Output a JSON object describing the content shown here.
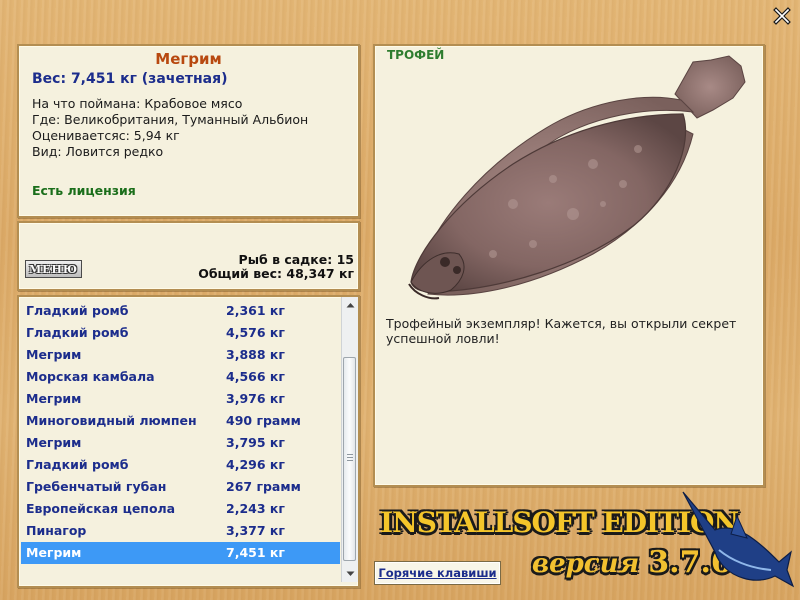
{
  "close": {
    "icon": "close-icon"
  },
  "catch_info": {
    "fish_name": "Мегрим",
    "weight": "Вес: 7,451 кг (зачетная)",
    "bait": "На что поймана: Крабовое мясо",
    "where": "Где: Великобритания, Туманный Альбион",
    "rated_from": "Оцениваетсяс: 5,94 кг",
    "kind": "Вид: Ловится редко",
    "license": "Есть лицензия"
  },
  "keepnet": {
    "menu_label": "МЕНЮ",
    "fish_count": "Рыб в садке: 15",
    "total_weight": "Общий вес: 48,347 кг"
  },
  "catch_list": {
    "rows": [
      {
        "name": "Гладкий ромб",
        "weight": "2,361 кг"
      },
      {
        "name": "Гладкий ромб",
        "weight": "4,576 кг"
      },
      {
        "name": "Мегрим",
        "weight": "3,888 кг"
      },
      {
        "name": "Морская камбала",
        "weight": "4,566 кг"
      },
      {
        "name": "Мегрим",
        "weight": "3,976 кг"
      },
      {
        "name": "Миноговидный люмпен",
        "weight": "490 грамм"
      },
      {
        "name": "Мегрим",
        "weight": "3,795 кг"
      },
      {
        "name": "Гладкий ромб",
        "weight": "4,296 кг"
      },
      {
        "name": "Гребенчатый губан",
        "weight": "267 грамм"
      },
      {
        "name": "Европейская цепола",
        "weight": "2,243 кг"
      },
      {
        "name": "Пинагор",
        "weight": "3,377 кг"
      },
      {
        "name": "Мегрим",
        "weight": "7,451 кг"
      }
    ],
    "selected_index": 11
  },
  "trophy": {
    "label": "ТРОФЕЙ",
    "message": "Трофейный экземпляр! Кажется, вы открыли секрет успешной ловли!"
  },
  "footer": {
    "hotkeys_label": "Горячие клавиши",
    "logo_text": "INSTALLSOFT EDITION",
    "version_word": "версия",
    "version_number": "3.7.6"
  }
}
